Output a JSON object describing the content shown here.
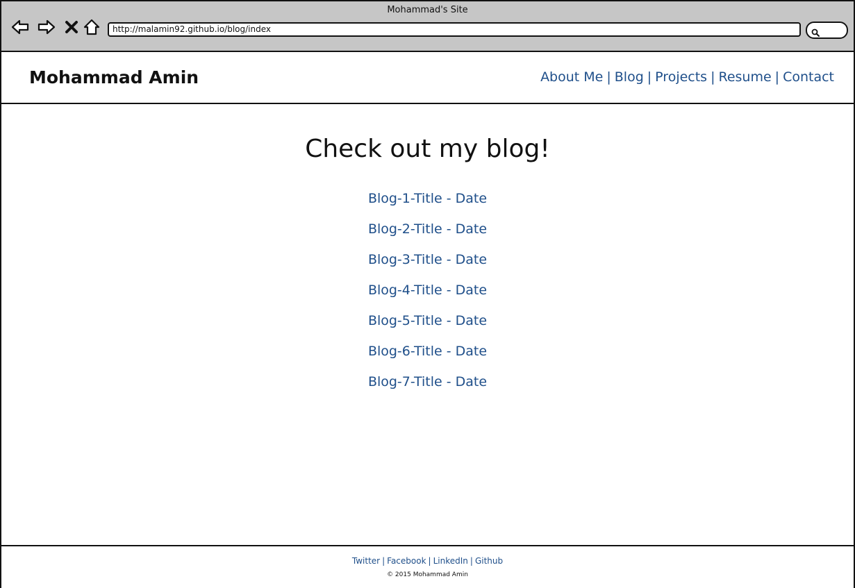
{
  "browser": {
    "window_title": "Mohammad's Site",
    "url": "http://malamin92.github.io/blog/index",
    "icons": [
      "back-icon",
      "forward-icon",
      "close-icon",
      "home-icon",
      "search-icon"
    ]
  },
  "header": {
    "site_title": "Mohammad Amin",
    "nav": [
      {
        "label": "About Me"
      },
      {
        "label": "Blog"
      },
      {
        "label": "Projects"
      },
      {
        "label": "Resume"
      },
      {
        "label": "Contact"
      }
    ],
    "separator": "|"
  },
  "main": {
    "heading": "Check out my blog!",
    "posts": [
      {
        "label": "Blog-1-Title - Date"
      },
      {
        "label": "Blog-2-Title - Date"
      },
      {
        "label": "Blog-3-Title - Date"
      },
      {
        "label": "Blog-4-Title - Date"
      },
      {
        "label": "Blog-5-Title - Date"
      },
      {
        "label": "Blog-6-Title - Date"
      },
      {
        "label": "Blog-7-Title - Date"
      }
    ]
  },
  "footer": {
    "links": [
      {
        "label": "Twitter"
      },
      {
        "label": "Facebook"
      },
      {
        "label": "LinkedIn"
      },
      {
        "label": "Github"
      }
    ],
    "separator": "|",
    "copyright": "© 2015 Mohammad Amin"
  },
  "colors": {
    "link": "#1f4f8a",
    "chrome": "#c6c6c6",
    "text": "#111111"
  }
}
